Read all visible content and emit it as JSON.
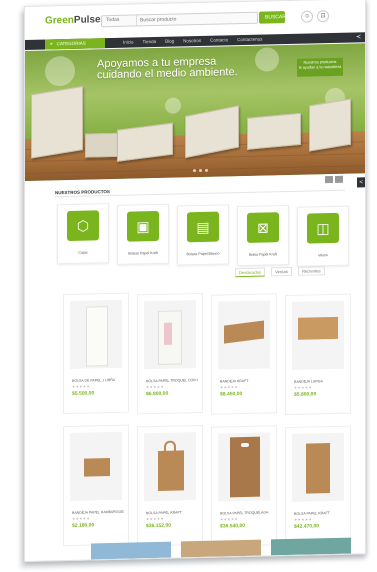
{
  "header": {
    "logo_main": "Green",
    "logo_accent": "Pulse",
    "search_category": "Todas",
    "search_placeholder": "Buscar producto",
    "search_button": "BUSCAR",
    "user_icon": "user-icon",
    "cart_icon": "cart-icon"
  },
  "nav": {
    "categories_label": "CATEGORIAS",
    "items": [
      "Inicio",
      "Tienda",
      "Blog",
      "Nosotros",
      "Contacto",
      "Contactenos"
    ]
  },
  "hero": {
    "line1": "Apoyamos a tu empresa",
    "line2": "cuidando el medio ambiente.",
    "badge_line1": "Nuestros productos",
    "badge_line2": "le ayudan a la naturaleza"
  },
  "products_section": {
    "title": "NUESTROS PRODUCTOS"
  },
  "categories": [
    {
      "label": "Cajas",
      "icon": "box-icon"
    },
    {
      "label": "Bolsas Papel Kraft",
      "icon": "bag-icon"
    },
    {
      "label": "Bolsas Papel Blanco",
      "icon": "bag-icon"
    },
    {
      "label": "Bolsa Papel Kraft",
      "icon": "bag-handle-icon"
    },
    {
      "label": "Vasos",
      "icon": "cup-icon"
    }
  ],
  "tabs": [
    "Destacados",
    "Ventas",
    "Recientes"
  ],
  "products": [
    {
      "name": "BOLSA DE PAPEL 1 LIBRA",
      "price": "$5.500,00"
    },
    {
      "name": "BOLSA PAPEL TROQUEL CON ASA",
      "price": "$6.800,00"
    },
    {
      "name": "BANDEJA KRAFT",
      "price": "$8.450,00"
    },
    {
      "name": "BANDEJA LARGA",
      "price": "$5.800,00"
    },
    {
      "name": "BANDEJA PAPEL HAMBURGUESA",
      "price": "$2.180,00"
    },
    {
      "name": "BOLSA PAPEL KRAFT",
      "price": "$36.152,00"
    },
    {
      "name": "BOLSA PAPEL TROQUELADA",
      "price": "$36.540,00"
    },
    {
      "name": "BOLSA PAPEL KRAFT",
      "price": "$42.470,00"
    }
  ],
  "stars": "★★★★★",
  "colors": {
    "brand_green": "#7ab51d",
    "nav_dark": "#2f3337",
    "kraft": "#b98a55"
  }
}
